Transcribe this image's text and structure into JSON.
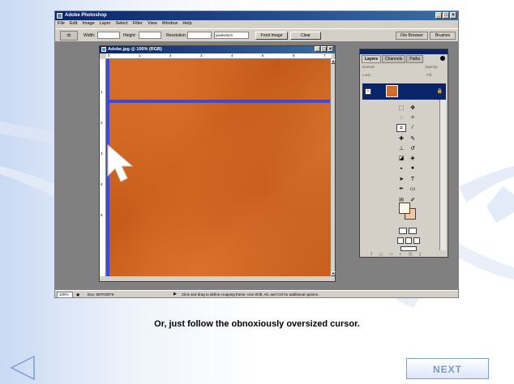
{
  "app": {
    "window_title": "Adobe Photoshop",
    "menu": [
      "File",
      "Edit",
      "Image",
      "Layer",
      "Select",
      "Filter",
      "View",
      "Window",
      "Help"
    ],
    "options_bar": {
      "width_label": "Width:",
      "height_label": "Height:",
      "resolution_label": "Resolution:",
      "units_value": "pixels/inch",
      "front_image_label": "Front Image",
      "clear_label": "Clear",
      "file_browser_label": "File Browser",
      "brushes_label": "Brushes"
    },
    "document": {
      "title": "Adobe.jpg @ 100% (RGB)",
      "ruler_h_marks": [
        "0",
        "1",
        "2",
        "3",
        "4",
        "5",
        "6",
        "7"
      ],
      "ruler_v_marks": [
        "1",
        "2",
        "3",
        "4",
        "5"
      ]
    },
    "layers_palette": {
      "tabs": [
        "Layers",
        "Channels",
        "Paths"
      ],
      "blend_mode": "Normal",
      "opacity_label": "Opacity:",
      "lock_label": "Lock:",
      "fill_label": "Fill:"
    },
    "status_bar": {
      "zoom": "100%",
      "doc_info": "Doc: 807K/807K",
      "message": "Click and drag to define cropping frame. Use Shift, Alt, and Ctrl for additional options."
    }
  },
  "slide": {
    "caption": "Or, just follow the obnoxiously oversized cursor.",
    "next_label": "NEXT"
  },
  "colors": {
    "accent_guide": "#3a4ae0",
    "canvas_orange": "#d36d28",
    "next_text": "#7d98c8"
  }
}
